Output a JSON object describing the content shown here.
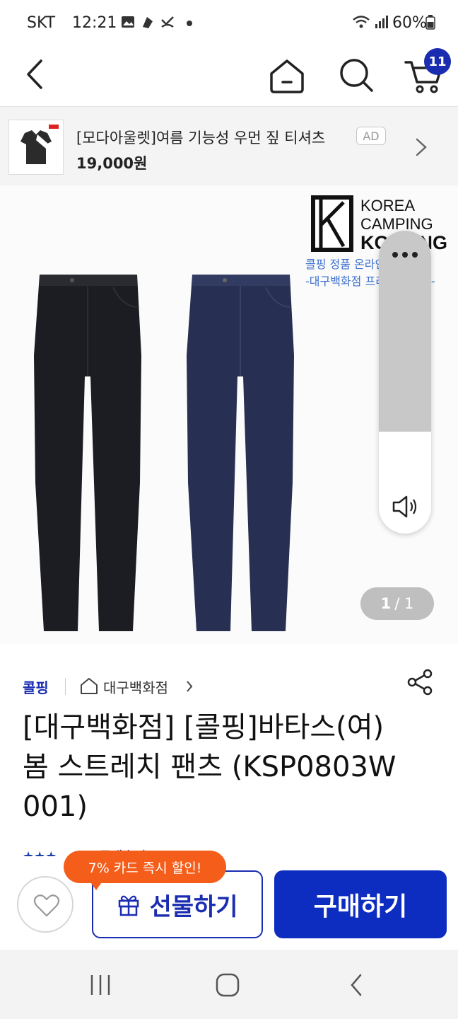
{
  "status_bar": {
    "carrier": "SKT",
    "time": "12:21",
    "battery": "60%"
  },
  "top_nav": {
    "cart_count": "11"
  },
  "ad": {
    "title": "[모다아울렛]여름 기능성 우먼 짚 티셔츠",
    "price": "19,000원",
    "badge": "AD"
  },
  "hero": {
    "brand_logo_lines": [
      "KOREA",
      "CAMPING",
      "KOLPING"
    ],
    "brand_sub_lines": [
      "콜핑 정품 온라인 판매처",
      "-대구백화점 프리미엄 쇼핑-"
    ],
    "pager_current": "1",
    "pager_total": "/ 1"
  },
  "product": {
    "brand": "콜핑",
    "store": "대구백화점",
    "title": "[대구백화점] [콜핑]바타스(여) 봄 스트레치 팬츠 (KSP0803W 001)",
    "rating_text": "★★★ ... (1) 구매후기"
  },
  "actions": {
    "promo": "7% 카드 즉시 할인!",
    "gift_label": "선물하기",
    "buy_label": "구매하기"
  },
  "colors": {
    "accent": "#1a2cb0",
    "buy": "#0d2cc0",
    "promo": "#f45e1a"
  }
}
